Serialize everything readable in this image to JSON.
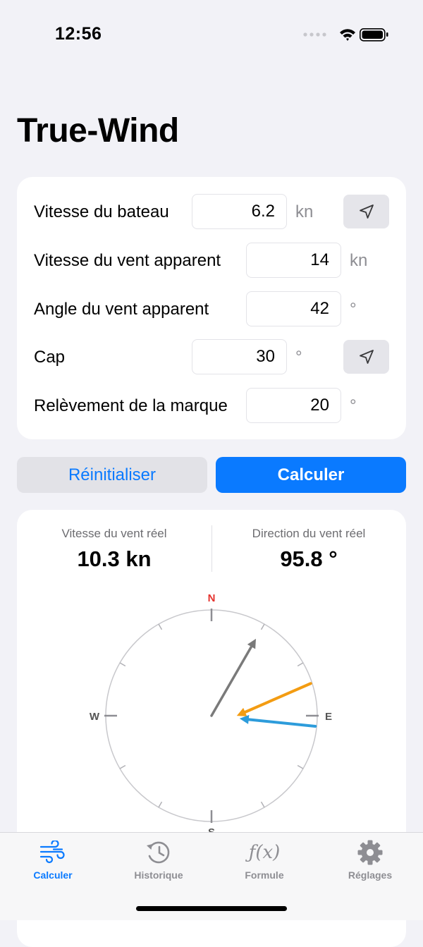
{
  "status": {
    "time": "12:56",
    "icons": [
      "signal-icon",
      "wifi-icon",
      "battery-icon"
    ]
  },
  "title": "True-Wind",
  "form": {
    "rows": [
      {
        "label": "Vitesse du bateau",
        "value": "6.2",
        "unit": "kn",
        "has_location": true
      },
      {
        "label": "Vitesse du vent apparent",
        "value": "14",
        "unit": "kn",
        "has_location": false
      },
      {
        "label": "Angle du vent apparent",
        "value": "42",
        "unit": "°",
        "has_location": false
      },
      {
        "label": "Cap",
        "value": "30",
        "unit": "°",
        "has_location": true
      },
      {
        "label": "Relèvement de la marque",
        "value": "20",
        "unit": "°",
        "has_location": false
      }
    ]
  },
  "buttons": {
    "reset": "Réinitialiser",
    "calculate": "Calculer"
  },
  "results": {
    "speed_label": "Vitesse du vent réel",
    "speed_value": "10.3 kn",
    "direction_label": "Direction du vent réel",
    "direction_value": "95.8 °"
  },
  "compass": {
    "cardinals": {
      "n": "N",
      "e": "E",
      "s": "S",
      "w": "W"
    },
    "heading_deg": 30,
    "apparent_wind_deg": 72,
    "true_wind_deg": 95.8,
    "colors": {
      "north": "#E5322D",
      "heading": "#7A7A7A",
      "apparent": "#F39C12",
      "true": "#2D9CDB"
    }
  },
  "tabs": [
    {
      "label": "Calculer",
      "icon": "wind-icon",
      "active": true
    },
    {
      "label": "Historique",
      "icon": "history-icon",
      "active": false
    },
    {
      "label": "Formule",
      "icon": "function-icon",
      "active": false
    },
    {
      "label": "Réglages",
      "icon": "gear-icon",
      "active": false
    }
  ],
  "accent": "#0A7AFF"
}
